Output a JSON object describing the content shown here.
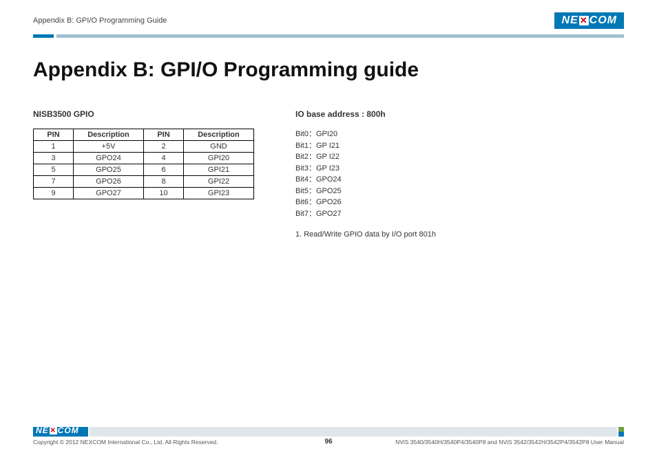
{
  "brand": "NEXCOM",
  "header": {
    "section_label": "Appendix B: GPI/O Programming Guide"
  },
  "title": "Appendix B: GPI/O Programming guide",
  "gpio_section": {
    "heading": "NISB3500 GPIO",
    "columns": [
      "PIN",
      "Description",
      "PIN",
      "Description"
    ],
    "rows": [
      {
        "pin_a": "1",
        "desc_a": "+5V",
        "pin_b": "2",
        "desc_b": "GND"
      },
      {
        "pin_a": "3",
        "desc_a": "GPO24",
        "pin_b": "4",
        "desc_b": "GPI20"
      },
      {
        "pin_a": "5",
        "desc_a": "GPO25",
        "pin_b": "6",
        "desc_b": "GPI21"
      },
      {
        "pin_a": "7",
        "desc_a": "GPO26",
        "pin_b": "8",
        "desc_b": "GPI22"
      },
      {
        "pin_a": "9",
        "desc_a": "GPO27",
        "pin_b": "10",
        "desc_b": "GPI23"
      }
    ]
  },
  "io_section": {
    "heading": "IO base address : 800h",
    "bits": [
      "Bit0：GPI20",
      "Bit1：GP I21",
      "Bit2：GP I22",
      "Bit3：GP I23",
      "Bit4：GPO24",
      "Bit5：GPO25",
      "Bit6：GPO26",
      "Bit7：GPO27"
    ],
    "note": "1. Read/Write GPIO data by I/O port 801h"
  },
  "footer": {
    "copyright": "Copyright © 2012 NEXCOM International Co., Ltd. All Rights Reserved.",
    "page": "96",
    "doc_ref": "NViS 3540/3540H/3540P4/3540P8 and NViS 3542/3542H/3542P4/3542P8 User Manual"
  }
}
